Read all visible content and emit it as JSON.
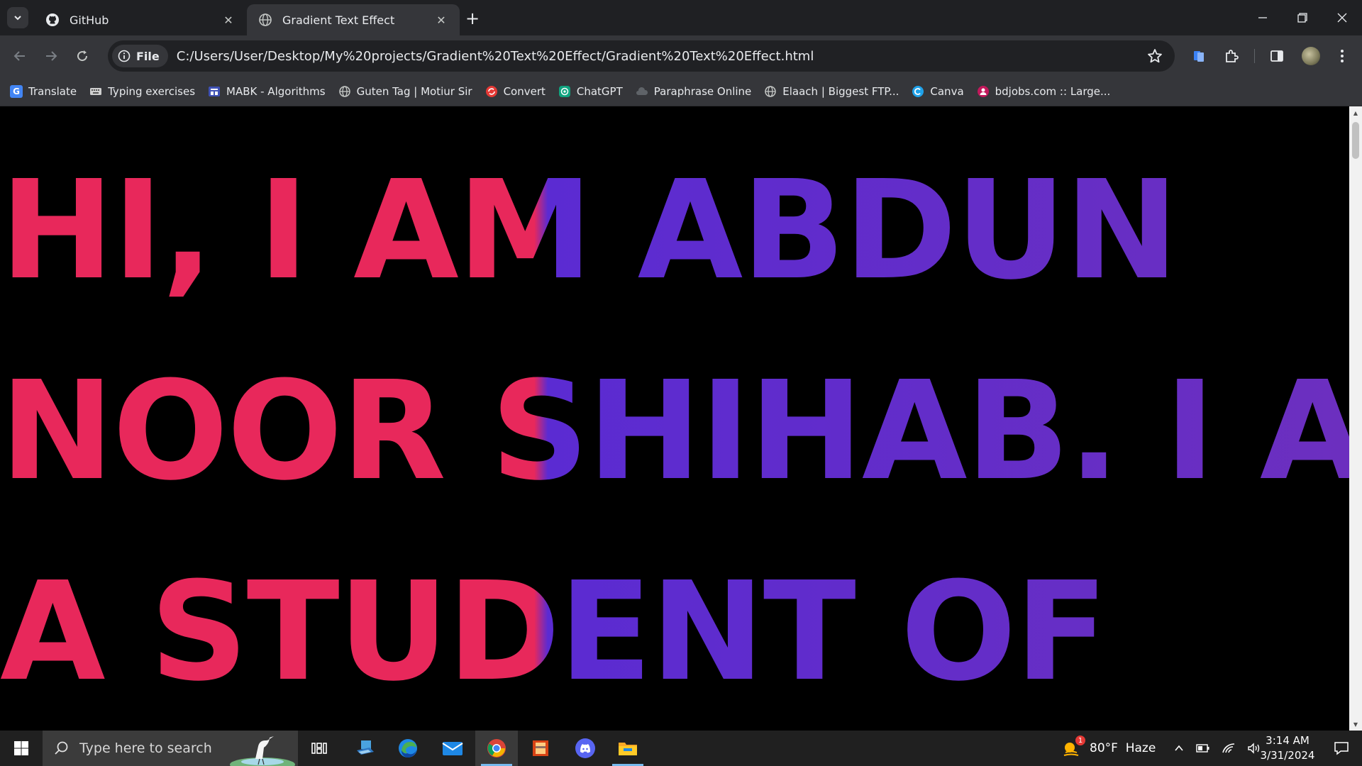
{
  "tabs": [
    {
      "title": "GitHub",
      "icon": "github-icon"
    },
    {
      "title": "Gradient Text Effect",
      "icon": "globe-icon"
    }
  ],
  "omnibox": {
    "chip_label": "File",
    "url": "C:/Users/User/Desktop/My%20projects/Gradient%20Text%20Effect/Gradient%20Text%20Effect.html"
  },
  "bookmarks": [
    {
      "label": "Translate",
      "icon": "google-translate-icon"
    },
    {
      "label": "Typing exercises",
      "icon": "keyboard-icon"
    },
    {
      "label": "MABK - Algorithms",
      "icon": "mabk-icon"
    },
    {
      "label": "Guten Tag | Motiur Sir",
      "icon": "globe-icon"
    },
    {
      "label": "Convert",
      "icon": "convert-icon"
    },
    {
      "label": "ChatGPT",
      "icon": "chatgpt-icon"
    },
    {
      "label": "Paraphrase Online",
      "icon": "cloud-icon"
    },
    {
      "label": "Elaach | Biggest FTP...",
      "icon": "globe-icon"
    },
    {
      "label": "Canva",
      "icon": "canva-icon"
    },
    {
      "label": "bdjobs.com :: Large...",
      "icon": "bdjobs-icon"
    }
  ],
  "page": {
    "lines": [
      "HI, I AM ABDUN",
      "NOOR SHIHAB. I AM",
      "A STUDENT OF"
    ],
    "colors": {
      "left": "#e8285b",
      "right": "#5b2bd2"
    }
  },
  "taskbar": {
    "search_placeholder": "Type here to search",
    "weather": "80°F  Haze",
    "weather_badge": "1",
    "time": "3:14 AM",
    "date": "3/31/2024"
  }
}
